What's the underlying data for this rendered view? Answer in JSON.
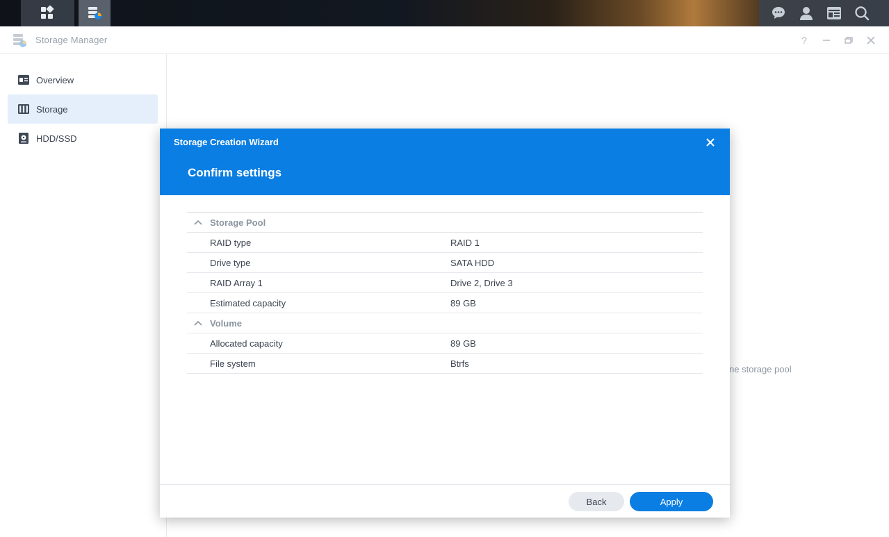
{
  "taskbar": {
    "left_icons": [
      "main-menu-icon"
    ],
    "active_app_icon": "storage-manager-icon",
    "right_icons": [
      "chat-icon",
      "user-icon",
      "widgets-icon",
      "search-icon"
    ]
  },
  "window": {
    "title": "Storage Manager",
    "controls": [
      "help-icon",
      "minimize-icon",
      "restore-icon",
      "close-icon"
    ]
  },
  "sidebar": {
    "items": [
      {
        "label": "Overview",
        "icon": "overview-icon",
        "active": false
      },
      {
        "label": "Storage",
        "icon": "storage-icon",
        "active": true
      },
      {
        "label": "HDD/SSD",
        "icon": "hdd-icon",
        "active": false
      }
    ]
  },
  "background": {
    "hint_text": "ne storage pool"
  },
  "wizard": {
    "title": "Storage Creation Wizard",
    "subtitle": "Confirm settings",
    "sections": [
      {
        "name": "Storage Pool",
        "rows": [
          {
            "key": "RAID type",
            "value": "RAID 1"
          },
          {
            "key": "Drive type",
            "value": "SATA HDD"
          },
          {
            "key": "RAID Array 1",
            "value": "Drive 2, Drive 3"
          },
          {
            "key": "Estimated capacity",
            "value": "89 GB"
          }
        ]
      },
      {
        "name": "Volume",
        "rows": [
          {
            "key": "Allocated capacity",
            "value": "89 GB"
          },
          {
            "key": "File system",
            "value": "Btrfs"
          }
        ]
      }
    ],
    "back_label": "Back",
    "apply_label": "Apply"
  },
  "colors": {
    "accent": "#0a7ee2",
    "sidebar_active": "#e4effb",
    "muted_text": "#8c96a1"
  }
}
